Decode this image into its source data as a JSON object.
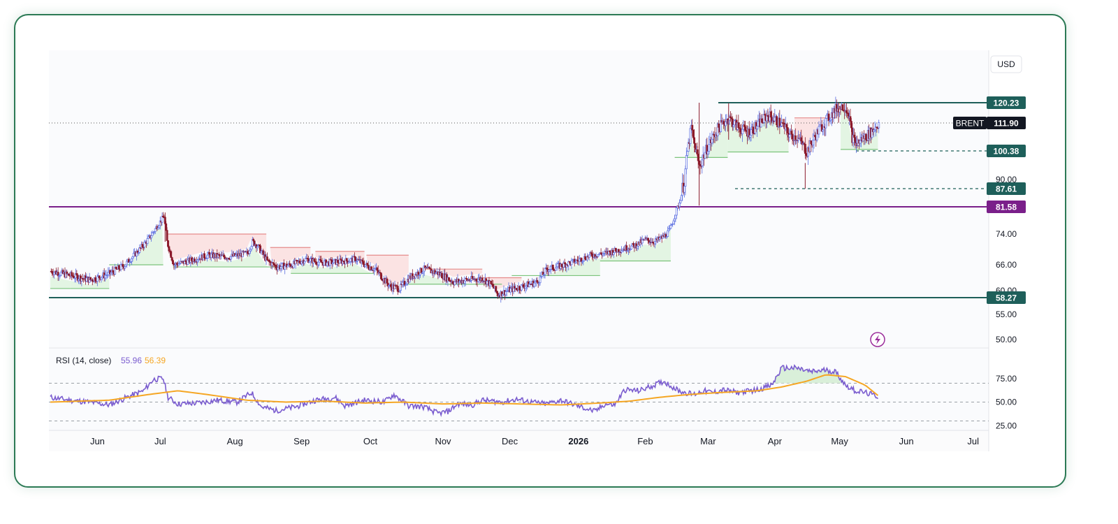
{
  "currency_label": "USD",
  "colors": {
    "up": "#5b6ee1",
    "down": "#8b1a2b",
    "support_fill": "#e3f5e3",
    "support_line": "#7cc47c",
    "resist_fill": "#fbe3e3",
    "resist_line": "#e58b8b",
    "teal": "#1e5f5a",
    "purple": "#7a1f8a",
    "rsi": "#7a5ccf",
    "rsi_ma": "#f5a623"
  },
  "chart_data": [
    {
      "type": "line",
      "series_name": "BRENT",
      "last_price": 111.9,
      "last_price_label": "111.90",
      "y_ticks": [
        "50.00",
        "55.00",
        "60.00",
        "66.00",
        "74.00",
        "90.00"
      ],
      "x_ticks": [
        "Jun",
        "Jul",
        "Aug",
        "Sep",
        "Oct",
        "Nov",
        "Dec",
        "2026",
        "Feb",
        "Mar",
        "Apr",
        "May",
        "Jun",
        "Jul"
      ],
      "levels": [
        {
          "value": 120.23,
          "label": "120.23",
          "style": "solid",
          "color": "#1e5f5a"
        },
        {
          "value": 100.38,
          "label": "100.38",
          "style": "dashed",
          "color": "#1e5f5a"
        },
        {
          "value": 87.61,
          "label": "87.61",
          "style": "dashed",
          "color": "#1e5f5a"
        },
        {
          "value": 81.58,
          "label": "81.58",
          "style": "solid",
          "color": "#7a1f8a"
        },
        {
          "value": 58.27,
          "label": "58.27",
          "style": "solid",
          "color": "#1e5f5a"
        }
      ],
      "price_anchors": [
        [
          0,
          64.5
        ],
        [
          20,
          63.5
        ],
        [
          40,
          62.5
        ],
        [
          60,
          64
        ],
        [
          75,
          66
        ],
        [
          90,
          70
        ],
        [
          100,
          73
        ],
        [
          110,
          77
        ],
        [
          115,
          79
        ],
        [
          118,
          72
        ],
        [
          125,
          66
        ],
        [
          140,
          67
        ],
        [
          160,
          68.5
        ],
        [
          180,
          68
        ],
        [
          190,
          68.5
        ],
        [
          200,
          69
        ],
        [
          205,
          72
        ],
        [
          210,
          71
        ],
        [
          220,
          67
        ],
        [
          230,
          65.5
        ],
        [
          245,
          66
        ],
        [
          260,
          67.5
        ],
        [
          270,
          66.8
        ],
        [
          280,
          66.5
        ],
        [
          300,
          67
        ],
        [
          310,
          67.5
        ],
        [
          320,
          66
        ],
        [
          330,
          65
        ],
        [
          345,
          61
        ],
        [
          355,
          60.5
        ],
        [
          365,
          63
        ],
        [
          380,
          65
        ],
        [
          395,
          64
        ],
        [
          410,
          62
        ],
        [
          425,
          62.5
        ],
        [
          440,
          62.8
        ],
        [
          450,
          61
        ],
        [
          455,
          59
        ],
        [
          465,
          60
        ],
        [
          480,
          61
        ],
        [
          495,
          62
        ],
        [
          505,
          65
        ],
        [
          515,
          65.5
        ],
        [
          535,
          67
        ],
        [
          550,
          68.5
        ],
        [
          565,
          69
        ],
        [
          580,
          70
        ],
        [
          595,
          71
        ],
        [
          605,
          72.5
        ],
        [
          615,
          72
        ],
        [
          625,
          73.5
        ],
        [
          630,
          75
        ],
        [
          640,
          83
        ],
        [
          645,
          90
        ],
        [
          648,
          100
        ],
        [
          652,
          110
        ],
        [
          655,
          103
        ],
        [
          660,
          95
        ],
        [
          670,
          103
        ],
        [
          680,
          110
        ],
        [
          690,
          114
        ],
        [
          700,
          110
        ],
        [
          710,
          108
        ],
        [
          720,
          111
        ],
        [
          730,
          115
        ],
        [
          738,
          113
        ],
        [
          745,
          111
        ],
        [
          752,
          107
        ],
        [
          760,
          106
        ],
        [
          765,
          103
        ],
        [
          770,
          100
        ],
        [
          775,
          104
        ],
        [
          782,
          109
        ],
        [
          790,
          113
        ],
        [
          800,
          118
        ],
        [
          808,
          119
        ],
        [
          812,
          116
        ],
        [
          816,
          106
        ],
        [
          820,
          103
        ],
        [
          825,
          105
        ],
        [
          835,
          108
        ],
        [
          843,
          111.9
        ]
      ],
      "resistance_segments": [
        [
          118,
          220,
          74,
          1
        ],
        [
          224,
          265,
          70.5,
          1
        ],
        [
          270,
          320,
          69.5,
          1
        ],
        [
          322,
          365,
          68.5,
          1
        ],
        [
          380,
          440,
          65,
          1
        ],
        [
          440,
          480,
          63,
          1
        ],
        [
          758,
          800,
          114,
          1
        ],
        [
          649,
          660,
          102,
          1
        ]
      ],
      "support_segments": [
        [
          0,
          20,
          60.5,
          0
        ],
        [
          20,
          60,
          60.5,
          0
        ],
        [
          60,
          115,
          66,
          0
        ],
        [
          125,
          240,
          65.5,
          0
        ],
        [
          245,
          330,
          64,
          0
        ],
        [
          360,
          460,
          61.5,
          0
        ],
        [
          470,
          560,
          63.5,
          0
        ],
        [
          560,
          632,
          67,
          0
        ],
        [
          636,
          690,
          98,
          0
        ],
        [
          690,
          752,
          100,
          0
        ],
        [
          805,
          843,
          101,
          0
        ]
      ]
    },
    {
      "type": "line",
      "title": "RSI (14, close)",
      "value_label": "55.96",
      "ma_label": "56.39",
      "y_ticks": [
        "25.00",
        "50.00",
        "75.00"
      ],
      "ylim": [
        20,
        100
      ],
      "guides": [
        30,
        50,
        70
      ],
      "rsi_anchors": [
        [
          0,
          55
        ],
        [
          20,
          52
        ],
        [
          40,
          50
        ],
        [
          60,
          47
        ],
        [
          80,
          56
        ],
        [
          95,
          62
        ],
        [
          105,
          74
        ],
        [
          115,
          75
        ],
        [
          120,
          55
        ],
        [
          130,
          48
        ],
        [
          150,
          49
        ],
        [
          170,
          52
        ],
        [
          190,
          50
        ],
        [
          205,
          60
        ],
        [
          215,
          45
        ],
        [
          230,
          41
        ],
        [
          250,
          45
        ],
        [
          270,
          52
        ],
        [
          290,
          55
        ],
        [
          300,
          46
        ],
        [
          320,
          52
        ],
        [
          340,
          50
        ],
        [
          350,
          58
        ],
        [
          365,
          46
        ],
        [
          380,
          45
        ],
        [
          395,
          38
        ],
        [
          405,
          40
        ],
        [
          415,
          48
        ],
        [
          430,
          47
        ],
        [
          440,
          52
        ],
        [
          460,
          50
        ],
        [
          475,
          53
        ],
        [
          490,
          50
        ],
        [
          505,
          48
        ],
        [
          520,
          52
        ],
        [
          540,
          45
        ],
        [
          555,
          40
        ],
        [
          565,
          48
        ],
        [
          575,
          47
        ],
        [
          585,
          63
        ],
        [
          600,
          62
        ],
        [
          615,
          68
        ],
        [
          625,
          72
        ],
        [
          640,
          62
        ],
        [
          655,
          58
        ],
        [
          665,
          62
        ],
        [
          675,
          60
        ],
        [
          685,
          63
        ],
        [
          700,
          60
        ],
        [
          720,
          63
        ],
        [
          735,
          68
        ],
        [
          745,
          86
        ],
        [
          760,
          86
        ],
        [
          775,
          82
        ],
        [
          790,
          84
        ],
        [
          800,
          82
        ],
        [
          810,
          68
        ],
        [
          820,
          62
        ],
        [
          830,
          60
        ],
        [
          843,
          56
        ]
      ],
      "ma_anchors": [
        [
          0,
          50
        ],
        [
          60,
          52
        ],
        [
          100,
          58
        ],
        [
          130,
          62
        ],
        [
          160,
          58
        ],
        [
          200,
          52
        ],
        [
          240,
          50
        ],
        [
          280,
          51
        ],
        [
          320,
          49
        ],
        [
          360,
          50
        ],
        [
          400,
          48
        ],
        [
          440,
          49
        ],
        [
          480,
          48
        ],
        [
          520,
          47
        ],
        [
          560,
          49
        ],
        [
          590,
          51
        ],
        [
          620,
          55
        ],
        [
          650,
          58
        ],
        [
          680,
          60
        ],
        [
          720,
          62
        ],
        [
          745,
          66
        ],
        [
          770,
          72
        ],
        [
          790,
          79
        ],
        [
          810,
          77
        ],
        [
          830,
          68
        ],
        [
          843,
          57
        ]
      ]
    }
  ]
}
